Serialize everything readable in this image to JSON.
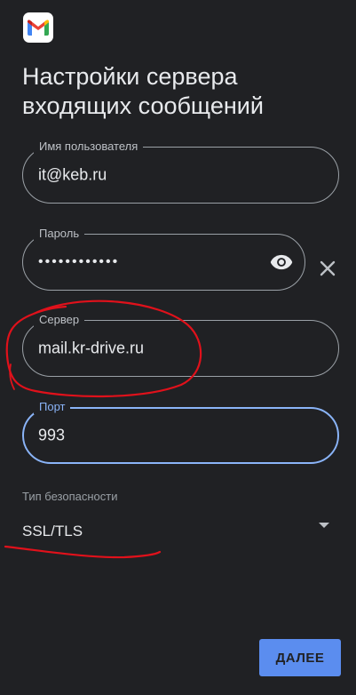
{
  "app": {
    "logo_icon": "gmail-logo-icon"
  },
  "page": {
    "title_line1": "Настройки сервера",
    "title_line2": "входящих сообщений"
  },
  "form": {
    "username": {
      "label": "Имя пользователя",
      "value": "it@keb.ru"
    },
    "password": {
      "label": "Пароль",
      "value": "••••••••••••",
      "toggle_icon": "eye-icon",
      "clear_icon": "close-icon"
    },
    "server": {
      "label": "Сервер",
      "value": "mail.kr-drive.ru"
    },
    "port": {
      "label": "Порт",
      "value": "993"
    },
    "security": {
      "label": "Тип безопасности",
      "value": "SSL/TLS",
      "dropdown_icon": "dropdown-arrow-icon"
    }
  },
  "actions": {
    "next_label": "ДАЛЕЕ"
  },
  "colors": {
    "background": "#202124",
    "focus": "#8ab4f8",
    "button": "#5b8def",
    "annotation": "#e0111b"
  }
}
